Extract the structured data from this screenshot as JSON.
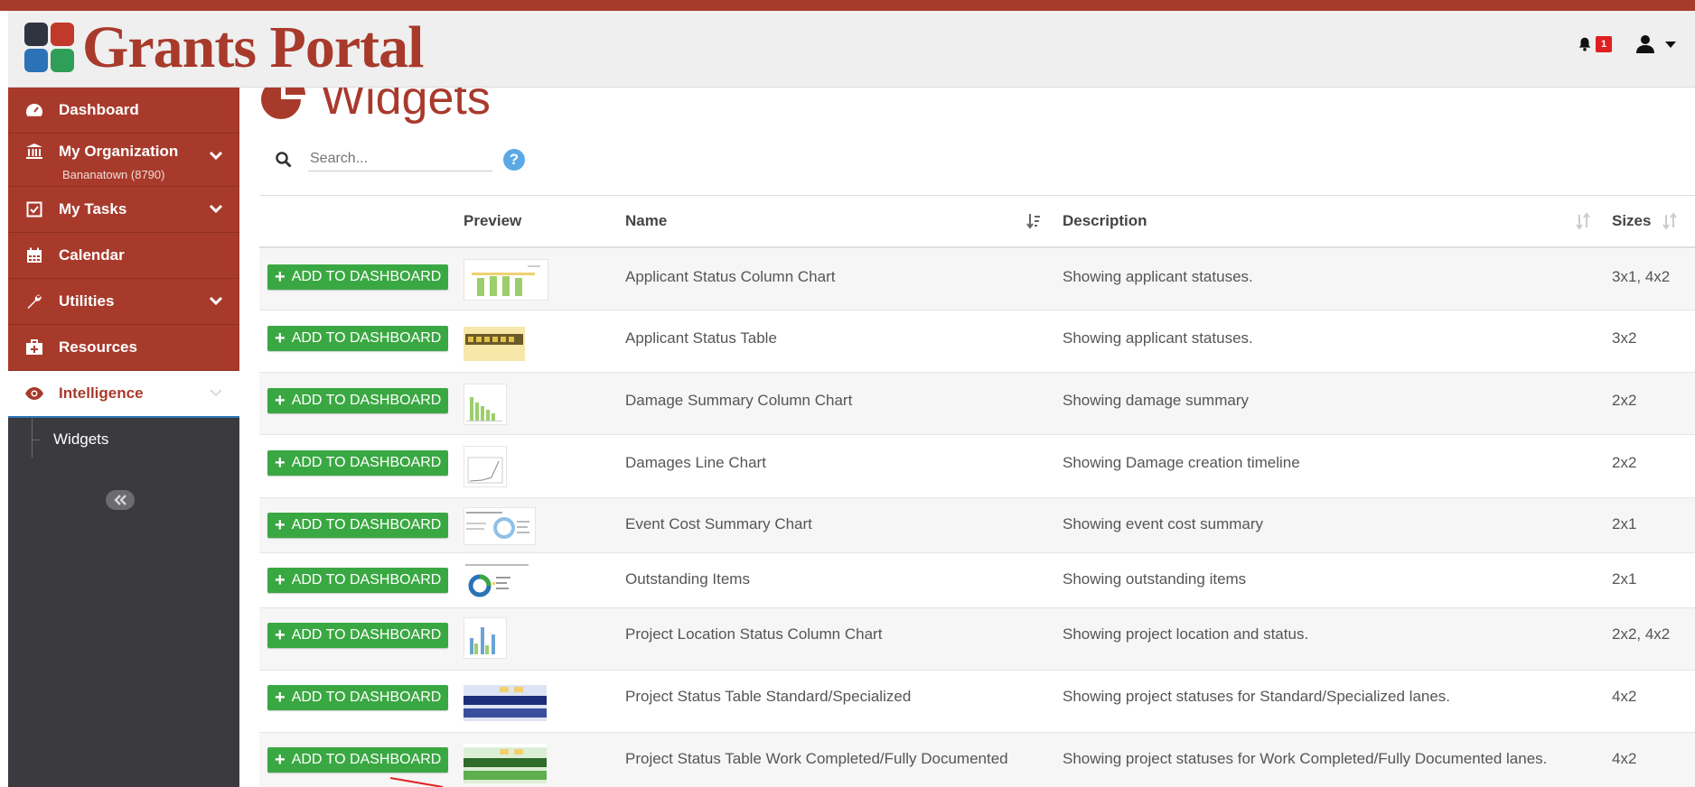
{
  "app": {
    "title": "Grants Portal",
    "notification_count": "1",
    "colors": {
      "brand": "#a83a2c",
      "add_button": "#3aa842",
      "sidebar": "#3a3a3f",
      "help": "#5aa9e6"
    }
  },
  "sidebar": {
    "items": [
      {
        "label": "Dashboard",
        "icon": "dashboard-icon"
      },
      {
        "label": "My Organization",
        "sublabel": "Bananatown (8790)",
        "icon": "bank-icon"
      },
      {
        "label": "My Tasks",
        "icon": "checkbox-icon"
      },
      {
        "label": "Calendar",
        "icon": "calendar-icon"
      },
      {
        "label": "Utilities",
        "icon": "wrench-icon"
      },
      {
        "label": "Resources",
        "icon": "briefcase-medical-icon"
      },
      {
        "label": "Intelligence",
        "icon": "eye-icon"
      }
    ],
    "subitems": [
      {
        "label": "Widgets"
      }
    ]
  },
  "main": {
    "title": "Widgets",
    "search": {
      "placeholder": "Search..."
    },
    "help": "?",
    "columns": {
      "preview": "Preview",
      "name": "Name",
      "description": "Description",
      "sizes": "Sizes"
    },
    "add_label": "ADD TO DASHBOARD",
    "rows": [
      {
        "name": "Applicant Status Column Chart",
        "description": "Showing applicant statuses.",
        "sizes": "3x1, 4x2"
      },
      {
        "name": "Applicant Status Table",
        "description": "Showing applicant statuses.",
        "sizes": "3x2"
      },
      {
        "name": "Damage Summary Column Chart",
        "description": "Showing damage summary",
        "sizes": "2x2"
      },
      {
        "name": "Damages Line Chart",
        "description": "Showing Damage creation timeline",
        "sizes": "2x2"
      },
      {
        "name": "Event Cost Summary Chart",
        "description": "Showing event cost summary",
        "sizes": "2x1"
      },
      {
        "name": "Outstanding Items",
        "description": "Showing outstanding items",
        "sizes": "2x1"
      },
      {
        "name": "Project Location Status Column Chart",
        "description": "Showing project location and status.",
        "sizes": "2x2, 4x2"
      },
      {
        "name": "Project Status Table Standard/Specialized",
        "description": "Showing project statuses for Standard/Specialized lanes.",
        "sizes": "4x2"
      },
      {
        "name": "Project Status Table Work Completed/Fully Documented",
        "description": "Showing project statuses for Work Completed/Fully Documented lanes.",
        "sizes": "4x2"
      }
    ]
  }
}
